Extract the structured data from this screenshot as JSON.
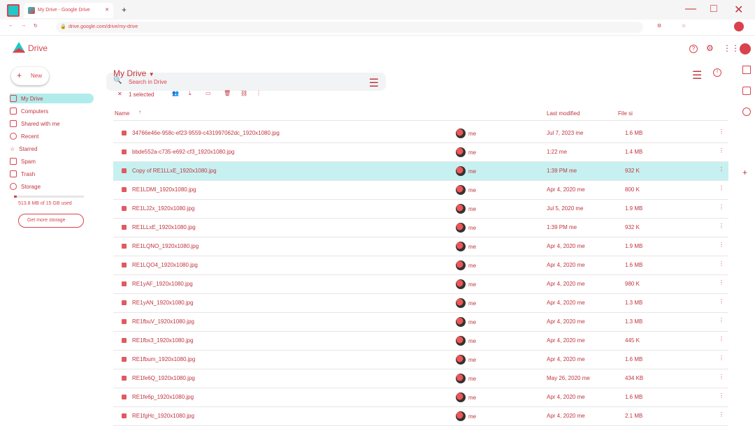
{
  "browser": {
    "tab_title": "My Drive - Google Drive",
    "new_tab": "+",
    "url": "drive.google.com/drive/my-drive"
  },
  "drive": {
    "brand": "Drive",
    "search_placeholder": "Search in Drive"
  },
  "sidebar": {
    "new_label": "New",
    "items": [
      {
        "label": "My Drive"
      },
      {
        "label": "Computers"
      },
      {
        "label": "Shared with me"
      },
      {
        "label": "Recent"
      },
      {
        "label": "Starred"
      },
      {
        "label": "Spam"
      },
      {
        "label": "Trash"
      },
      {
        "label": "Storage"
      }
    ],
    "storage_used": "513.8 MB of 15 GB used",
    "get_more_storage": "Get more storage"
  },
  "main": {
    "title": "My Drive",
    "selected_text": "1 selected",
    "columns": {
      "name": "Name",
      "modified": "Last modified",
      "size": "File si"
    },
    "rows": [
      {
        "name": "34766e46e-958c-ef23-9559-c431997062dc_1920x1080.jpg",
        "owner": "me",
        "modified": "Jul 7, 2023 me",
        "size": "1.6 MB"
      },
      {
        "name": "bbde552a-c735-e692-cf3_1920x1080.jpg",
        "owner": "me",
        "modified": "1:22 me",
        "size": "1.4 MB"
      },
      {
        "name": "Copy of RE1LLxE_1920x1080.jpg",
        "owner": "me",
        "modified": "1:39 PM me",
        "size": "932 K"
      },
      {
        "name": "RE1LDMI_1920x1080.jpg",
        "owner": "me",
        "modified": "Apr 4, 2020 me",
        "size": "800 K"
      },
      {
        "name": "RE1LJ2x_1920x1080.jpg",
        "owner": "me",
        "modified": "Jul 5, 2020 me",
        "size": "1.9 MB"
      },
      {
        "name": "RE1LLxE_1920x1080.jpg",
        "owner": "me",
        "modified": "1:39 PM me",
        "size": "932 K"
      },
      {
        "name": "RE1LQNO_1920x1080.jpg",
        "owner": "me",
        "modified": "Apr 4, 2020 me",
        "size": "1.9 MB"
      },
      {
        "name": "RE1LQO4_1920x1080.jpg",
        "owner": "me",
        "modified": "Apr 4, 2020 me",
        "size": "1.6 MB"
      },
      {
        "name": "RE1yAF_1920x1080.jpg",
        "owner": "me",
        "modified": "Apr 4, 2020 me",
        "size": "980 K"
      },
      {
        "name": "RE1yAN_1920x1080.jpg",
        "owner": "me",
        "modified": "Apr 4, 2020 me",
        "size": "1.3 MB"
      },
      {
        "name": "RE1fbuV_1920x1080.jpg",
        "owner": "me",
        "modified": "Apr 4, 2020 me",
        "size": "1.3 MB"
      },
      {
        "name": "RE1fbx3_1920x1080.jpg",
        "owner": "me",
        "modified": "Apr 4, 2020 me",
        "size": "445 K"
      },
      {
        "name": "RE1fbum_1920x1080.jpg",
        "owner": "me",
        "modified": "Apr 4, 2020 me",
        "size": "1.6 MB"
      },
      {
        "name": "RE1fe6Q_1920x1080.jpg",
        "owner": "me",
        "modified": "May 26, 2020 me",
        "size": "434 KB"
      },
      {
        "name": "RE1fe6p_1920x1080.jpg",
        "owner": "me",
        "modified": "Apr 4, 2020 me",
        "size": "1.6 MB"
      },
      {
        "name": "RE1fgHc_1920x1080.jpg",
        "owner": "me",
        "modified": "Apr 4, 2020 me",
        "size": "2.1 MB"
      }
    ]
  },
  "colors": {
    "cyan": "#1fc9c9",
    "red": "#d8434d"
  }
}
